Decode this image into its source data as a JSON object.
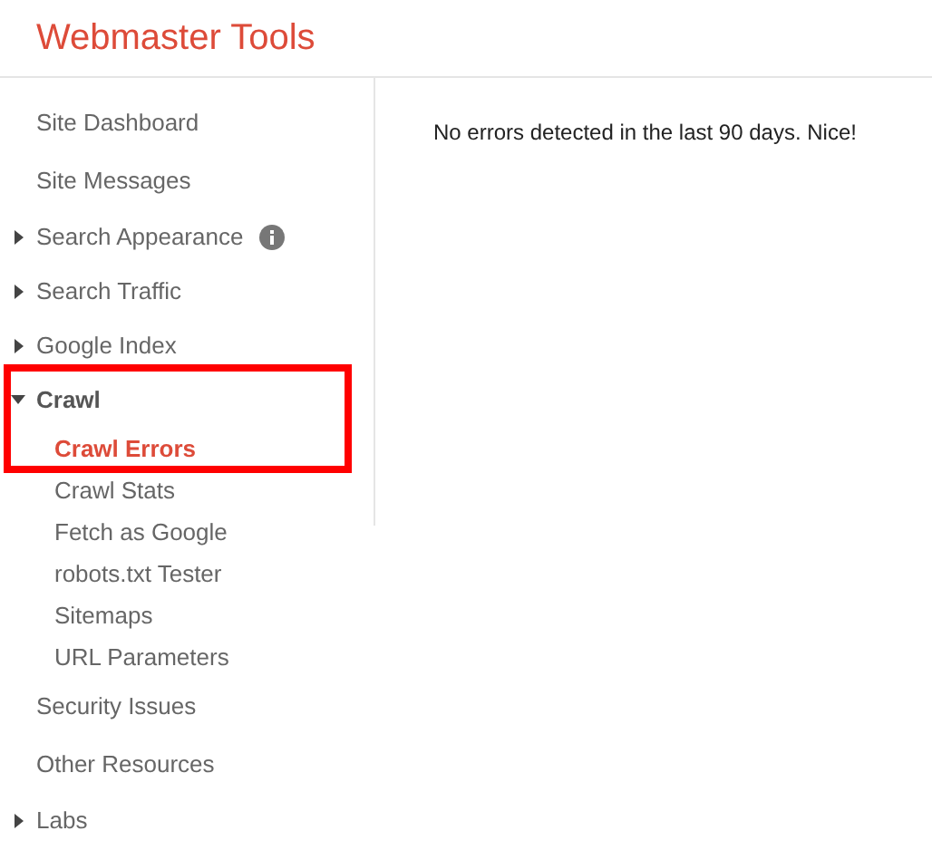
{
  "header": {
    "title": "Webmaster Tools"
  },
  "sidebar": {
    "items": [
      {
        "label": "Site Dashboard"
      },
      {
        "label": "Site Messages"
      },
      {
        "label": "Search Appearance",
        "expandable": true,
        "expanded": false,
        "info": true
      },
      {
        "label": "Search Traffic",
        "expandable": true,
        "expanded": false
      },
      {
        "label": "Google Index",
        "expandable": true,
        "expanded": false
      },
      {
        "label": "Crawl",
        "expandable": true,
        "expanded": true,
        "highlighted": true,
        "children": [
          {
            "label": "Crawl Errors",
            "selected": true
          },
          {
            "label": "Crawl Stats",
            "selected": false
          },
          {
            "label": "Fetch as Google",
            "selected": false
          },
          {
            "label": "robots.txt Tester",
            "selected": false
          },
          {
            "label": "Sitemaps",
            "selected": false
          },
          {
            "label": "URL Parameters",
            "selected": false
          }
        ]
      },
      {
        "label": "Security Issues"
      },
      {
        "label": "Other Resources"
      },
      {
        "label": "Labs",
        "expandable": true,
        "expanded": false
      }
    ]
  },
  "content": {
    "message": "No errors detected in the last 90 days. Nice!"
  }
}
